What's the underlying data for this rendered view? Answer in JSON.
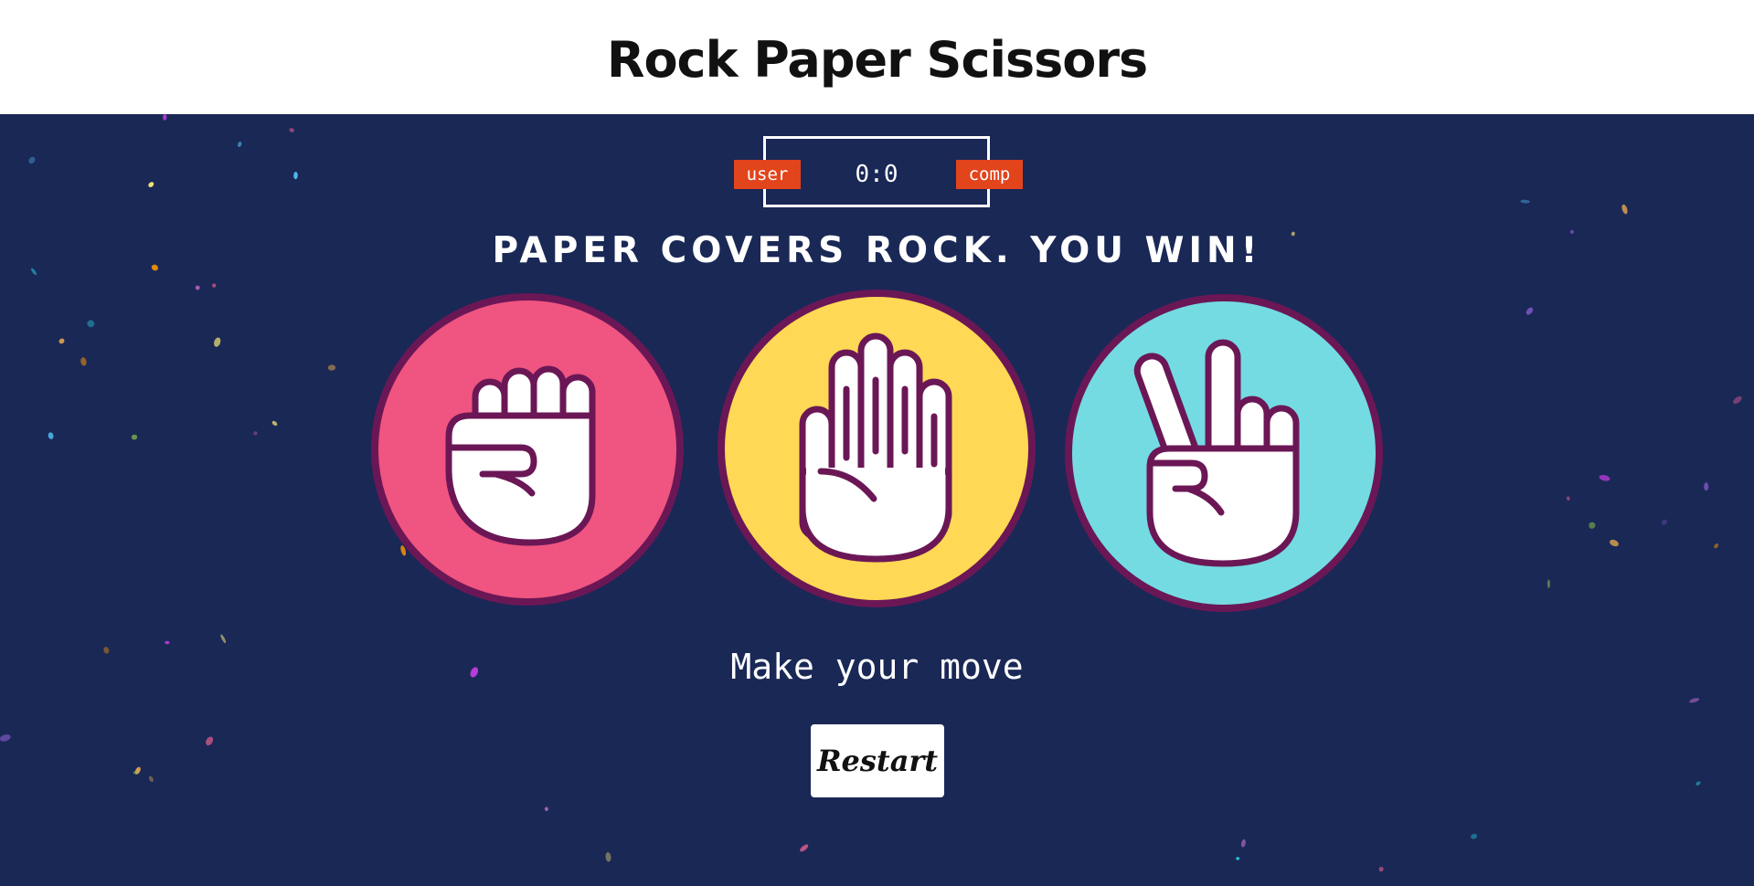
{
  "header": {
    "title": "Rock Paper Scissors"
  },
  "score": {
    "user_label": "user",
    "comp_label": "comp",
    "value": "0:0"
  },
  "result_text": "Paper covers rock. You win!",
  "choices": [
    {
      "name": "rock",
      "icon": "fist-icon",
      "color": "#ef5580"
    },
    {
      "name": "paper",
      "icon": "open-hand-icon",
      "color": "#ffd955"
    },
    {
      "name": "scissors",
      "icon": "peace-hand-icon",
      "color": "#74dbe3"
    }
  ],
  "prompt": "Make your move",
  "restart_label": "Restart",
  "colors": {
    "background": "#1a2856",
    "header_bg": "#ffffff",
    "badge": "#e2441c",
    "outline": "#6b1756"
  }
}
